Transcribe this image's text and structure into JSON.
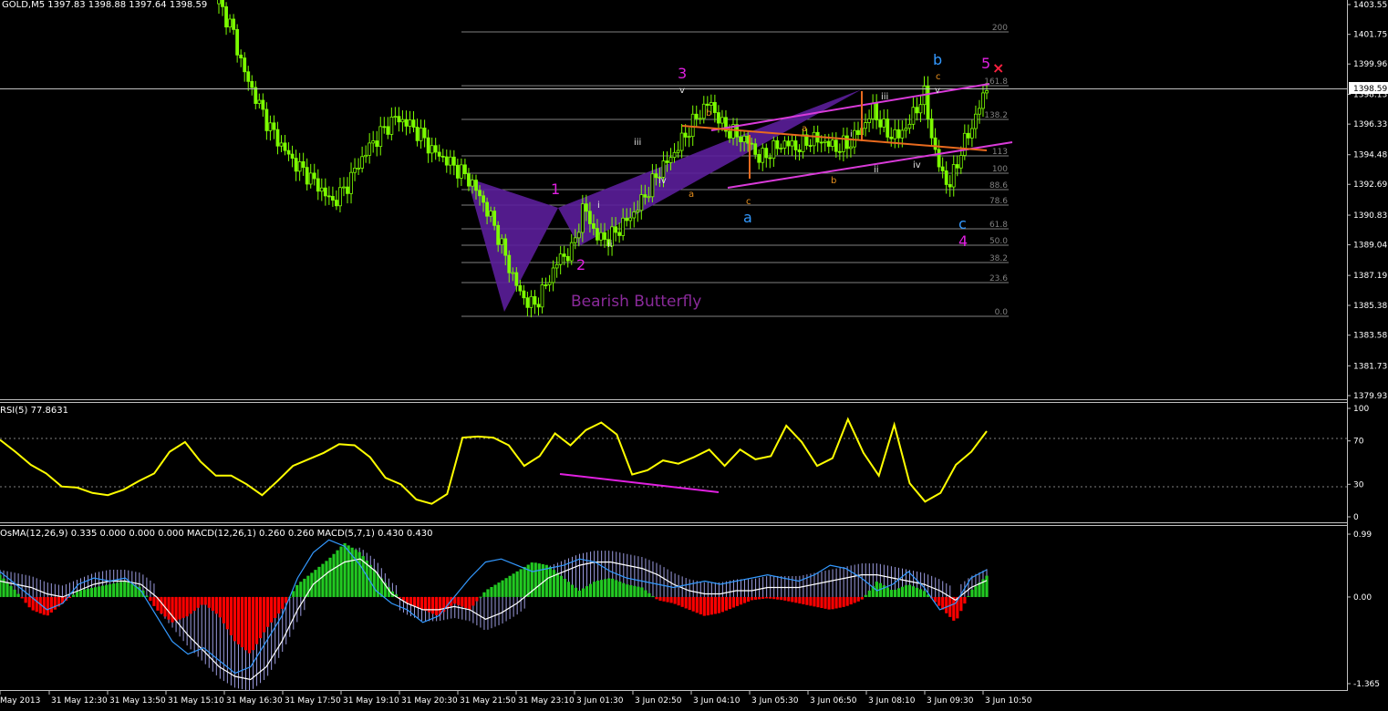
{
  "header": {
    "main": "GOLD,M5  1397.83 1398.88 1397.64 1398.59",
    "rsi": "RSI(5) 77.8631",
    "macd": "OsMA(12,26,9) 0.335 0.000 0.000 0.000  MACD(12,26,1) 0.260 0.260  MACD(5,7,1) 0.430 0.430"
  },
  "colors": {
    "background": "#000000",
    "candle": "#7CFC00",
    "grid": "#C0C0C0",
    "fib": "#808080",
    "butterfly": "#5B1E9A",
    "channel": "#D93BD9",
    "orange": "#E86A1E",
    "rsi": "#FFFF00",
    "osma_pos": "#22C922",
    "osma_neg": "#FF0000",
    "wave_magenta": "#E020E0",
    "wave_blue": "#3399FF"
  },
  "price_axis": {
    "ticks": [
      "1403.55",
      "1401.75",
      "1399.96",
      "1398.13",
      "1396.33",
      "1394.48",
      "1392.69",
      "1390.83",
      "1389.04",
      "1387.19",
      "1385.38",
      "1383.58",
      "1381.73",
      "1379.93"
    ],
    "current": "1398.59"
  },
  "rsi_axis": {
    "ticks": [
      "100",
      "70",
      "30",
      "0"
    ]
  },
  "macd_axis": {
    "ticks": [
      "0.99",
      "0.00",
      "-1.365"
    ]
  },
  "time_axis": {
    "labels": [
      "May 2013",
      "31 May 12:30",
      "31 May 13:50",
      "31 May 15:10",
      "31 May 16:30",
      "31 May 17:50",
      "31 May 19:10",
      "31 May 20:30",
      "31 May 21:50",
      "31 May 23:10",
      "3 Jun 01:30",
      "3 Jun 02:50",
      "3 Jun 04:10",
      "3 Jun 05:30",
      "3 Jun 06:50",
      "3 Jun 08:10",
      "3 Jun 09:30",
      "3 Jun 10:50"
    ]
  },
  "fib_levels": [
    "200",
    "161.8",
    "138.2",
    "113",
    "100",
    "88.6",
    "78.6",
    "61.8",
    "50.0",
    "38.2",
    "23.6",
    "0.0"
  ],
  "annotations": {
    "pattern": "Bearish Butterfly",
    "w1": "1",
    "w2": "2",
    "w3": "3",
    "w4": "4",
    "w5": "5",
    "a_big": "a",
    "b_big": "b",
    "c_big": "c",
    "sub_i": "i",
    "sub_ii": "ii",
    "sub_iii": "iii",
    "sub_iv": "iv",
    "sub_v": "v",
    "or_a": "a",
    "or_b": "b",
    "or_c": "c",
    "marker": "×"
  },
  "chart_data": [
    {
      "type": "line",
      "title": "GOLD,M5",
      "series": [
        {
          "name": "GOLD",
          "values": [
            1403.6,
            1402.2,
            1399.5,
            1397.8,
            1396.2,
            1395.0,
            1394.0,
            1393.3,
            1392.5,
            1391.6,
            1392.4,
            1393.8,
            1395.0,
            1395.9,
            1396.7,
            1396.4,
            1395.7,
            1394.7,
            1394.2,
            1393.6,
            1392.9,
            1391.6,
            1390.0,
            1387.8,
            1386.0,
            1385.3,
            1386.6,
            1388.2,
            1388.6,
            1391.4,
            1389.5,
            1389.4,
            1390.2,
            1391.0,
            1392.2,
            1393.5,
            1394.4,
            1395.6,
            1396.8,
            1397.7,
            1396.2,
            1395.7,
            1395.3,
            1394.2,
            1394.8,
            1395.2,
            1394.9,
            1395.4,
            1395.3,
            1394.9,
            1395.1,
            1396.0,
            1397.2,
            1395.8,
            1395.6,
            1396.6,
            1398.2,
            1394.2,
            1392.5,
            1394.8,
            1396.5,
            1398.6
          ]
        }
      ],
      "ylim": [
        1379.93,
        1403.55
      ],
      "fib_levels": [
        "200",
        "161.8",
        "138.2",
        "113",
        "100",
        "88.6",
        "78.6",
        "61.8",
        "50.0",
        "38.2",
        "23.6",
        "0.0"
      ]
    },
    {
      "type": "line",
      "title": "RSI(5) 77.8631",
      "series": [
        {
          "name": "RSI(5)",
          "values": [
            71,
            60,
            48,
            40,
            28,
            27,
            22,
            20,
            25,
            33,
            40,
            60,
            69,
            51,
            38,
            38,
            30,
            20,
            33,
            47,
            53,
            59,
            67,
            66,
            55,
            36,
            30,
            16,
            12,
            21,
            73,
            74,
            73,
            66,
            47,
            56,
            77,
            66,
            80,
            87,
            76,
            39,
            43,
            52,
            49,
            55,
            62,
            47,
            62,
            53,
            56,
            84,
            69,
            47,
            54,
            90,
            59,
            38,
            85,
            31,
            14,
            22,
            48,
            60,
            79
          ]
        }
      ],
      "ylim": [
        0,
        100
      ]
    },
    {
      "type": "bar",
      "title": "OsMA(12,26,9)",
      "series": [
        {
          "name": "OsMA(12,26,9)",
          "values": [
            0.35,
            0.1,
            -0.2,
            -0.3,
            -0.1,
            0.1,
            0.15,
            0.2,
            0.25,
            0.15,
            -0.2,
            -0.4,
            -0.3,
            -0.1,
            -0.3,
            -0.7,
            -0.9,
            -0.5,
            -0.2,
            0.2,
            0.4,
            0.6,
            0.85,
            0.7,
            0.4,
            0.1,
            -0.1,
            -0.2,
            -0.3,
            -0.1,
            -0.2,
            0.1,
            0.25,
            0.4,
            0.55,
            0.5,
            0.3,
            0.1,
            0.25,
            0.3,
            0.2,
            0.15,
            -0.05,
            -0.1,
            -0.2,
            -0.3,
            -0.25,
            -0.15,
            -0.05,
            -0.02,
            -0.05,
            -0.1,
            -0.15,
            -0.2,
            -0.15,
            -0.05,
            0.25,
            0.1,
            0.2,
            0.1,
            -0.15,
            -0.4,
            0.1,
            0.335
          ]
        },
        {
          "name": "MACD(12,26,1)",
          "values": [
            0.25,
            0.2,
            0.15,
            0.05,
            0.0,
            0.1,
            0.2,
            0.25,
            0.25,
            0.2,
            0.0,
            -0.3,
            -0.6,
            -0.85,
            -1.1,
            -1.25,
            -1.3,
            -1.1,
            -0.7,
            -0.2,
            0.2,
            0.4,
            0.55,
            0.6,
            0.4,
            0.05,
            -0.1,
            -0.2,
            -0.2,
            -0.15,
            -0.2,
            -0.35,
            -0.25,
            -0.1,
            0.1,
            0.3,
            0.4,
            0.5,
            0.55,
            0.55,
            0.5,
            0.45,
            0.35,
            0.2,
            0.1,
            0.05,
            0.05,
            0.1,
            0.1,
            0.15,
            0.15,
            0.15,
            0.2,
            0.25,
            0.3,
            0.35,
            0.35,
            0.3,
            0.25,
            0.2,
            0.1,
            -0.05,
            0.15,
            0.26
          ]
        },
        {
          "name": "MACD(5,7,1)",
          "values": [
            0.4,
            0.2,
            0.0,
            -0.2,
            -0.1,
            0.2,
            0.3,
            0.25,
            0.3,
            0.1,
            -0.3,
            -0.7,
            -0.9,
            -0.8,
            -1.0,
            -1.2,
            -1.1,
            -0.7,
            -0.3,
            0.3,
            0.7,
            0.9,
            0.8,
            0.5,
            0.1,
            -0.1,
            -0.2,
            -0.4,
            -0.3,
            0.0,
            0.3,
            0.55,
            0.6,
            0.5,
            0.4,
            0.45,
            0.5,
            0.6,
            0.55,
            0.4,
            0.3,
            0.25,
            0.2,
            0.15,
            0.2,
            0.25,
            0.2,
            0.25,
            0.3,
            0.35,
            0.3,
            0.25,
            0.35,
            0.5,
            0.45,
            0.3,
            0.1,
            0.2,
            0.4,
            0.15,
            -0.2,
            -0.1,
            0.3,
            0.43
          ]
        }
      ],
      "ylim": [
        -1.365,
        0.99
      ]
    }
  ]
}
